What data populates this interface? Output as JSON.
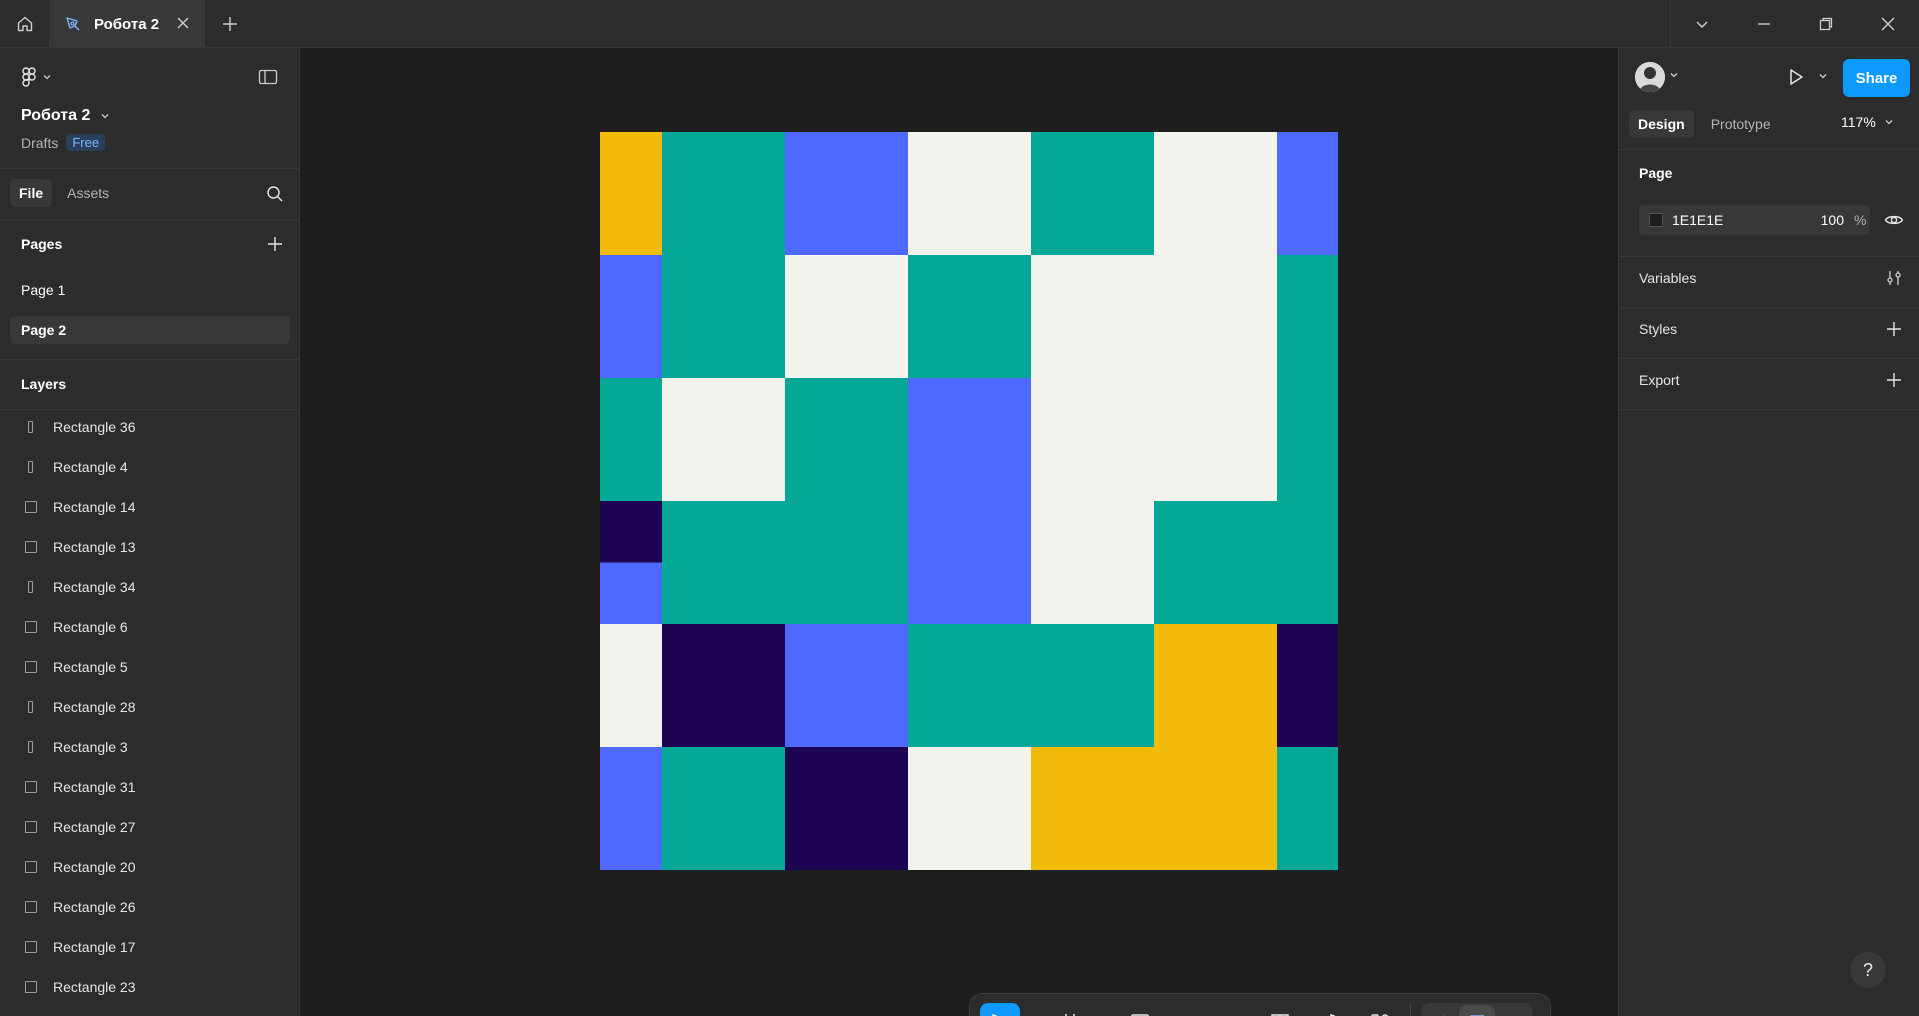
{
  "app": {
    "tab_title": "Робота 2",
    "icons": {
      "home": "home-icon",
      "tab_file": "pen-tool-icon",
      "close": "close-icon",
      "new_tab": "plus-icon",
      "chevron": "chevron-down-icon",
      "minimize": "minimize-icon",
      "restore": "restore-icon",
      "window_close": "close-icon"
    }
  },
  "left_panel": {
    "file_name": "Робота 2",
    "location": "Drafts",
    "plan_badge": "Free",
    "tabs": [
      {
        "label": "File",
        "active": true
      },
      {
        "label": "Assets",
        "active": false
      }
    ],
    "pages_header": "Pages",
    "pages": [
      {
        "label": "Page 1",
        "active": false
      },
      {
        "label": "Page 2",
        "active": true
      }
    ],
    "layers_header": "Layers",
    "layers": [
      {
        "label": "Rectangle 36",
        "shape": "thin"
      },
      {
        "label": "Rectangle 4",
        "shape": "thin"
      },
      {
        "label": "Rectangle 14",
        "shape": "square"
      },
      {
        "label": "Rectangle 13",
        "shape": "square"
      },
      {
        "label": "Rectangle 34",
        "shape": "thin"
      },
      {
        "label": "Rectangle 6",
        "shape": "square"
      },
      {
        "label": "Rectangle 5",
        "shape": "square"
      },
      {
        "label": "Rectangle 28",
        "shape": "thin"
      },
      {
        "label": "Rectangle 3",
        "shape": "thin"
      },
      {
        "label": "Rectangle 31",
        "shape": "square"
      },
      {
        "label": "Rectangle 27",
        "shape": "square"
      },
      {
        "label": "Rectangle 20",
        "shape": "square"
      },
      {
        "label": "Rectangle 26",
        "shape": "square"
      },
      {
        "label": "Rectangle 17",
        "shape": "square"
      },
      {
        "label": "Rectangle 23",
        "shape": "square"
      }
    ]
  },
  "canvas": {
    "background": "#1E1E1E",
    "palette": {
      "Y": "#f2bb0c",
      "T": "#05a896",
      "B": "#4e69ff",
      "W": "#f3f2ec",
      "N": "#1d0453"
    },
    "grid": [
      [
        "Y",
        "T",
        "B",
        "W",
        "T",
        "W",
        "B"
      ],
      [
        "B",
        "T",
        "W",
        "T",
        "W",
        "W",
        "T"
      ],
      [
        "T",
        "W",
        "T",
        "B",
        "W",
        "W",
        "T"
      ],
      [
        "N/B",
        "T",
        "T",
        "B",
        "W",
        "T",
        "T"
      ],
      [
        "W",
        "N",
        "B",
        "T",
        "T",
        "Y",
        "N"
      ],
      [
        "B",
        "T",
        "N",
        "W",
        "Y",
        "Y",
        "T"
      ]
    ]
  },
  "toolbar": {
    "tools": [
      "move-icon",
      "frame-icon",
      "rectangle-icon",
      "pen-icon",
      "text-icon",
      "comment-icon",
      "actions-icon"
    ],
    "modes": [
      "draw-mode-icon",
      "design-mode-icon",
      "dev-mode-icon"
    ]
  },
  "right_panel": {
    "share_label": "Share",
    "tabs": [
      {
        "label": "Design",
        "active": true
      },
      {
        "label": "Prototype",
        "active": false
      }
    ],
    "zoom": "117%",
    "page_section": "Page",
    "page_fill_hex": "1E1E1E",
    "page_fill_opacity": "100",
    "page_fill_unit": "%",
    "variables_label": "Variables",
    "styles_label": "Styles",
    "export_label": "Export",
    "help_label": "?"
  }
}
